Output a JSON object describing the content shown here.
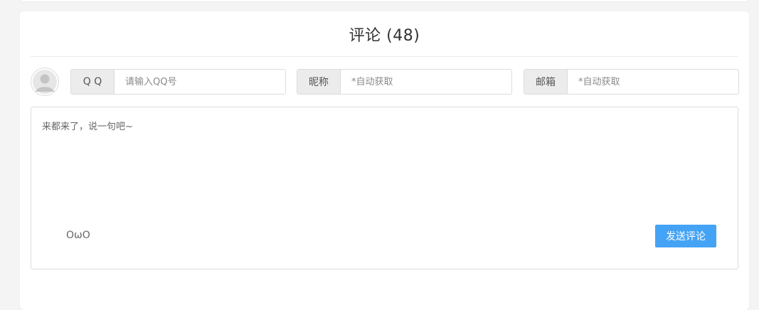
{
  "comments": {
    "title": "评论 (48)"
  },
  "form": {
    "qq": {
      "label": "Q Q",
      "placeholder": "请输入QQ号"
    },
    "nickname": {
      "label": "昵称",
      "placeholder": "*自动获取"
    },
    "email": {
      "label": "邮箱",
      "placeholder": "*自动获取"
    },
    "comment_placeholder": "来都来了，说一句吧~",
    "emoji_toggle": "OωO",
    "submit_label": "发送评论"
  },
  "icons": {
    "avatar": "default-avatar-icon"
  },
  "colors": {
    "submit_button": "#45a3f5",
    "label_bg": "#ececec",
    "border": "#dcdcdc"
  }
}
